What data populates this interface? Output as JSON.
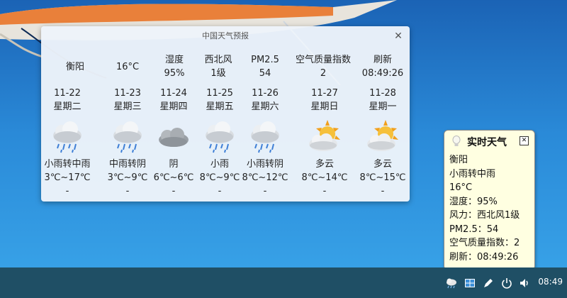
{
  "window": {
    "title": "中国天气预报"
  },
  "current": {
    "city": "衡阳",
    "temp": "16°C",
    "humidity_label": "湿度",
    "humidity": "95%",
    "wind_dir": "西北风",
    "wind_level": "1级",
    "pm_label": "PM2.5",
    "pm": "54",
    "aqi_label": "空气质量指数",
    "aqi": "2",
    "refresh_label": "刷新",
    "refresh_time": "08:49:26"
  },
  "days": [
    {
      "date": "11-22",
      "weekday": "星期二",
      "icon": "rain-cloud-icon",
      "desc": "小雨转中雨",
      "temp": "3℃~17℃",
      "extra": "-"
    },
    {
      "date": "11-23",
      "weekday": "星期三",
      "icon": "rain-cloud-icon",
      "desc": "中雨转阴",
      "temp": "3℃~9℃",
      "extra": "-"
    },
    {
      "date": "11-24",
      "weekday": "星期四",
      "icon": "overcast-icon",
      "desc": "阴",
      "temp": "6℃~6℃",
      "extra": "-"
    },
    {
      "date": "11-25",
      "weekday": "星期五",
      "icon": "rain-cloud-icon",
      "desc": "小雨",
      "temp": "8℃~9℃",
      "extra": "-"
    },
    {
      "date": "11-26",
      "weekday": "星期六",
      "icon": "rain-cloud-icon",
      "desc": "小雨转阴",
      "temp": "8℃~12℃",
      "extra": "-"
    },
    {
      "date": "11-27",
      "weekday": "星期日",
      "icon": "partly-cloudy-icon",
      "desc": "多云",
      "temp": "8℃~14℃",
      "extra": "-"
    },
    {
      "date": "11-28",
      "weekday": "星期一",
      "icon": "partly-cloudy-icon",
      "desc": "多云",
      "temp": "8℃~15℃",
      "extra": "-"
    }
  ],
  "tooltip": {
    "title": "实时天气",
    "lines": [
      "衡阳",
      "小雨转中雨",
      "16°C",
      "湿度：95%",
      "风力：西北风1级",
      "PM2.5：54",
      "空气质量指数：2",
      "刷新：08:49:26"
    ]
  },
  "taskbar": {
    "clock": "08:49",
    "icons": [
      "weather-tray-icon",
      "window-switcher-icon",
      "pen-icon",
      "power-icon",
      "volume-icon"
    ]
  }
}
